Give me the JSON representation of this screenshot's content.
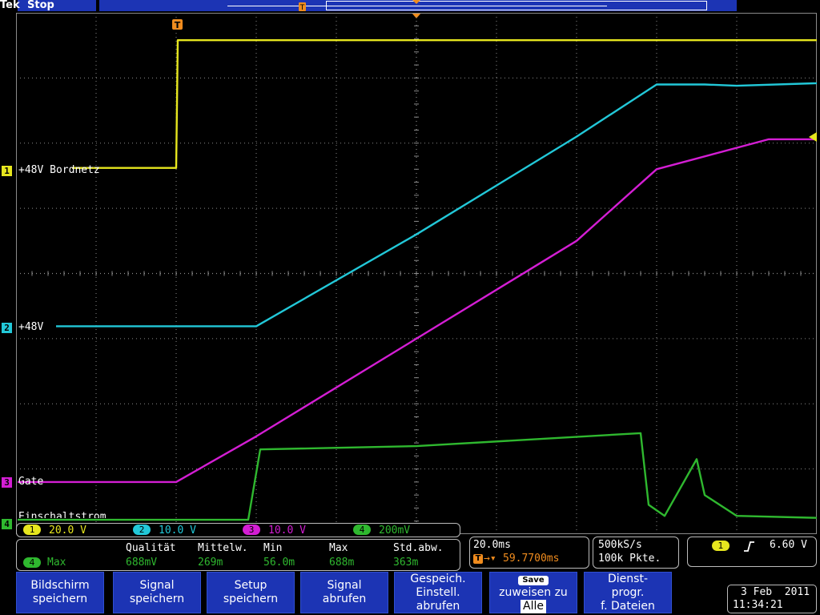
{
  "header": {
    "brand": "Tek",
    "state": "Stop",
    "trigger_marker": "T"
  },
  "colors": {
    "ch1": "#e6e61e",
    "ch2": "#22c8d8",
    "ch3": "#d41ed4",
    "ch4": "#2fb82f",
    "button_bg": "#1c34b4",
    "trigger_orange": "#f08c1e"
  },
  "channels": [
    {
      "num": "1",
      "label": "+48V Bordnetz",
      "scale": "20.0 V"
    },
    {
      "num": "2",
      "label": "+48V",
      "scale": "10.0 V"
    },
    {
      "num": "3",
      "label": "Gate",
      "scale": "10.0 V"
    },
    {
      "num": "4",
      "label": "Einschaltstrom",
      "scale": "200mV"
    }
  ],
  "measurement": {
    "channel": "4",
    "name": "Max",
    "headers": [
      "Qualität",
      "Mittelw.",
      "Min",
      "Max",
      "Std.abw."
    ],
    "values": [
      "688mV",
      "269m",
      "56.0m",
      "688m",
      "363m"
    ]
  },
  "timebase": {
    "scale": "20.0ms",
    "trigger_position": "59.7700ms",
    "trigger_prefix": "T",
    "sample_rate": "500kS/s",
    "record_length": "100k Pkte."
  },
  "trigger": {
    "source": "1",
    "slope_icon": "rising-edge-icon",
    "level": "6.60 V"
  },
  "softkeys": [
    {
      "line1": "Bildschirm",
      "line2": "speichern",
      "line3": ""
    },
    {
      "line1": "Signal",
      "line2": "speichern",
      "line3": ""
    },
    {
      "line1": "Setup",
      "line2": "speichern",
      "line3": ""
    },
    {
      "line1": "Signal",
      "line2": "abrufen",
      "line3": ""
    },
    {
      "line1": "Gespeich.",
      "line2": "Einstell.",
      "line3": "abrufen"
    },
    {
      "badge": "Save",
      "line1": "zuweisen zu",
      "line2": "Alle"
    },
    {
      "line1": "Dienst-",
      "line2": "progr.",
      "line3": "f. Dateien"
    }
  ],
  "datetime": {
    "date": "3 Feb  2011",
    "time": "11:34:21"
  },
  "chart_data": {
    "type": "line",
    "title": "",
    "x_unit": "div",
    "y_unit": "div",
    "xlim": [
      -5,
      5
    ],
    "ylim": [
      -4,
      4
    ],
    "grid": true,
    "series": [
      {
        "name": "+48V Bordnetz",
        "channel": "1",
        "x": [
          -4.3,
          -3.0,
          -2.98,
          5.0
        ],
        "y": [
          1.62,
          1.62,
          3.58,
          3.58
        ]
      },
      {
        "name": "+48V",
        "channel": "2",
        "x": [
          -4.5,
          -2.0,
          0.0,
          2.0,
          3.0,
          3.6,
          4.0,
          5.0
        ],
        "y": [
          -0.81,
          -0.81,
          0.6,
          2.1,
          2.9,
          2.9,
          2.88,
          2.92
        ]
      },
      {
        "name": "Gate",
        "channel": "3",
        "x": [
          -4.98,
          -3.0,
          -2.0,
          0.0,
          2.0,
          3.0,
          4.4,
          5.0
        ],
        "y": [
          -3.2,
          -3.2,
          -2.5,
          -1.0,
          0.5,
          1.6,
          2.06,
          2.06
        ]
      },
      {
        "name": "Einschaltstrom",
        "channel": "4",
        "x": [
          -4.98,
          -3.0,
          -2.1,
          -1.95,
          0.0,
          2.8,
          2.9,
          3.1,
          3.5,
          3.6,
          4.0,
          5.0
        ],
        "y": [
          -3.78,
          -3.78,
          -3.78,
          -2.7,
          -2.65,
          -2.45,
          -3.55,
          -3.72,
          -2.85,
          -3.4,
          -3.72,
          -3.75
        ]
      }
    ]
  }
}
